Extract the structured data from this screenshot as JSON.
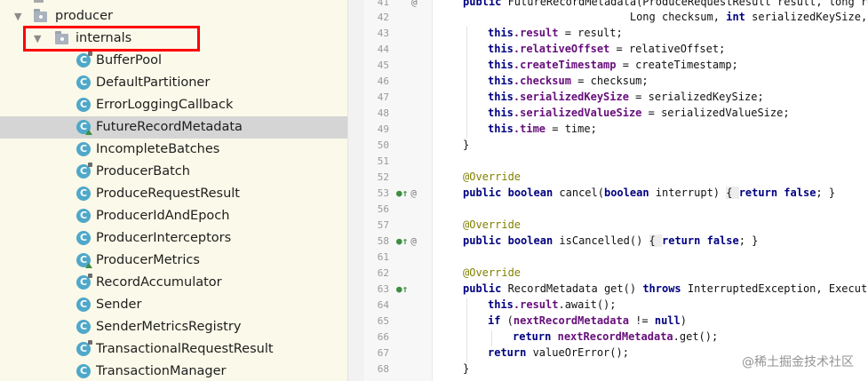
{
  "tree": {
    "packages": [
      {
        "label": "producer",
        "expanded": true
      },
      {
        "label": "internals",
        "expanded": true,
        "highlighted": true
      }
    ],
    "classes": [
      {
        "label": "BufferPool",
        "selected": false
      },
      {
        "label": "DefaultPartitioner",
        "selected": false
      },
      {
        "label": "ErrorLoggingCallback",
        "selected": false
      },
      {
        "label": "FutureRecordMetadata",
        "selected": true
      },
      {
        "label": "IncompleteBatches",
        "selected": false
      },
      {
        "label": "ProducerBatch",
        "selected": false
      },
      {
        "label": "ProduceRequestResult",
        "selected": false
      },
      {
        "label": "ProducerIdAndEpoch",
        "selected": false
      },
      {
        "label": "ProducerInterceptors",
        "selected": false
      },
      {
        "label": "ProducerMetrics",
        "selected": false
      },
      {
        "label": "RecordAccumulator",
        "selected": false
      },
      {
        "label": "Sender",
        "selected": false
      },
      {
        "label": "SenderMetricsRegistry",
        "selected": false
      },
      {
        "label": "TransactionalRequestResult",
        "selected": false
      },
      {
        "label": "TransactionManager",
        "selected": false
      }
    ],
    "expanded_arrow": "▼",
    "class_icon_letter": "C"
  },
  "editor": {
    "line_numbers": [
      "41",
      "42",
      "43",
      "44",
      "45",
      "46",
      "47",
      "48",
      "49",
      "50",
      "51",
      "52",
      "53",
      "56",
      "57",
      "58",
      "61",
      "62",
      "63",
      "64",
      "65",
      "66",
      "67",
      "68"
    ],
    "gutter_markers": {
      "override": "●↑",
      "at": "@"
    },
    "code": {
      "l41": {
        "kw": "public",
        "rest": " FutureRecordMetadata(ProduceRequestResult result, long rel"
      },
      "l42": {
        "pre": "                          Long checksum, ",
        "kw": "int",
        "rest": " serializedKeySize, i"
      },
      "l43": {
        "kw": "this",
        "fld": ".result",
        "rest": " = result;"
      },
      "l44": {
        "kw": "this",
        "fld": ".relativeOffset",
        "rest": " = relativeOffset;"
      },
      "l45": {
        "kw": "this",
        "fld": ".createTimestamp",
        "rest": " = createTimestamp;"
      },
      "l46": {
        "kw": "this",
        "fld": ".checksum",
        "rest": " = checksum;"
      },
      "l47": {
        "kw": "this",
        "fld": ".serializedKeySize",
        "rest": " = serializedKeySize;"
      },
      "l48": {
        "kw": "this",
        "fld": ".serializedValueSize",
        "rest": " = serializedValueSize;"
      },
      "l49": {
        "kw": "this",
        "fld": ".time",
        "rest": " = time;"
      },
      "l50": {
        "rest": "}"
      },
      "l52": {
        "ann": "@Override"
      },
      "l53": {
        "kw1": "public",
        "kw2": "boolean",
        "mid": " cancel(",
        "kw3": "boolean",
        "after": " interrupt) ",
        "brace_open": "{ ",
        "kw4": "return",
        "kw5": "false",
        "tail": "; }"
      },
      "l57": {
        "ann": "@Override"
      },
      "l58": {
        "kw1": "public",
        "kw2": "boolean",
        "mid": " isCancelled() ",
        "brace_open": "{ ",
        "kw4": "return",
        "kw5": "false",
        "tail": "; }"
      },
      "l62": {
        "ann": "@Override"
      },
      "l63": {
        "kw1": "public",
        "mid": " RecordMetadata get() ",
        "kw2": "throws",
        "rest": " InterruptedException, Executio"
      },
      "l64": {
        "kw": "this",
        "fld": ".result",
        "rest": ".await();"
      },
      "l65": {
        "kw": "if",
        "pre": " (",
        "fld": "nextRecordMetadata",
        "mid": " != ",
        "kw2": "null",
        "rest": ")"
      },
      "l66": {
        "kw": "return",
        "fld": "nextRecordMetadata",
        "rest": ".get();"
      },
      "l67": {
        "kw": "return",
        "rest": " valueOrError();"
      },
      "l68": {
        "rest": "}"
      }
    }
  },
  "watermark": "@稀土掘金技术社区"
}
